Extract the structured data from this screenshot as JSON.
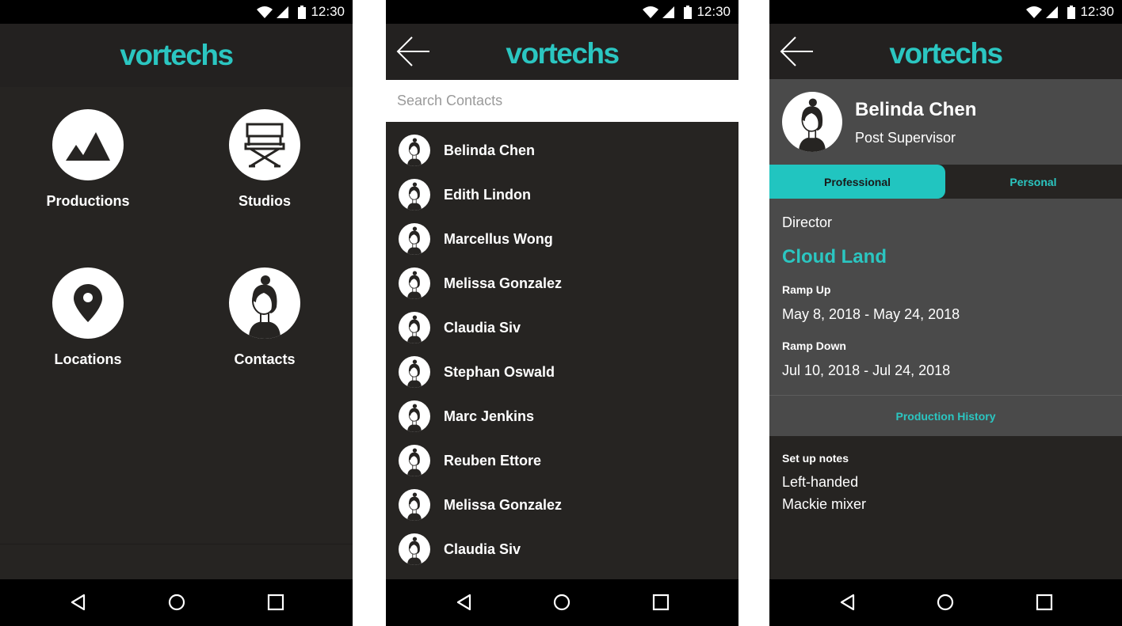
{
  "status": {
    "time": "12:30"
  },
  "brand": {
    "logo": "vortechs",
    "accent": "#2bc6c1"
  },
  "home": {
    "tiles": [
      {
        "label": "Productions",
        "icon": "mountains-icon"
      },
      {
        "label": "Studios",
        "icon": "director-chair-icon"
      },
      {
        "label": "Locations",
        "icon": "map-pin-icon"
      },
      {
        "label": "Contacts",
        "icon": "person-icon"
      }
    ]
  },
  "contacts": {
    "search_placeholder": "Search Contacts",
    "items": [
      {
        "name": "Belinda Chen"
      },
      {
        "name": "Edith Lindon"
      },
      {
        "name": "Marcellus Wong"
      },
      {
        "name": "Melissa Gonzalez"
      },
      {
        "name": "Claudia Siv"
      },
      {
        "name": "Stephan Oswald"
      },
      {
        "name": "Marc Jenkins"
      },
      {
        "name": "Reuben Ettore"
      },
      {
        "name": "Melissa Gonzalez"
      },
      {
        "name": "Claudia Siv"
      }
    ]
  },
  "detail": {
    "name": "Belinda Chen",
    "title": "Post Supervisor",
    "tabs": [
      {
        "label": "Professional",
        "active": true
      },
      {
        "label": "Personal",
        "active": false
      }
    ],
    "role": "Director",
    "production": "Cloud Land",
    "ramp_up_label": "Ramp Up",
    "ramp_up_dates": "May 8, 2018 - May 24, 2018",
    "ramp_down_label": "Ramp Down",
    "ramp_down_dates": "Jul 10, 2018 - Jul 24, 2018",
    "history_link": "Production History",
    "notes_label": "Set up notes",
    "notes_lines": [
      "Left-handed",
      "Mackie mixer"
    ]
  }
}
